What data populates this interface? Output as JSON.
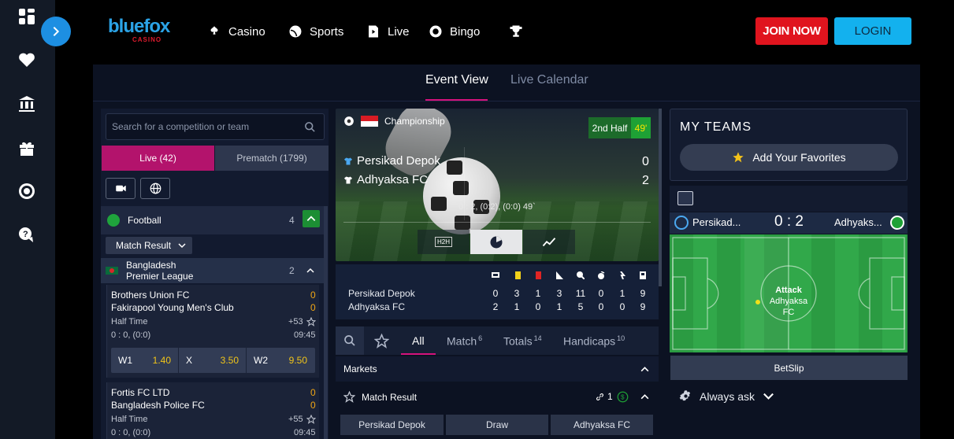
{
  "brand": {
    "name": "bluefox",
    "sub": "CASINO"
  },
  "nav": [
    "Casino",
    "Sports",
    "Live",
    "Bingo"
  ],
  "auth": {
    "join": "JOIN NOW",
    "login": "LOGIN"
  },
  "view_tabs": {
    "event_view": "Event View",
    "live_calendar": "Live Calendar"
  },
  "left": {
    "search_placeholder": "Search for a competition or team",
    "live_tab": "Live (42)",
    "prematch_tab": "Prematch (1799)",
    "sport": {
      "name": "Football",
      "count": "4"
    },
    "market_select": "Match Result",
    "league": {
      "name_line1": "Bangladesh",
      "name_line2": "Premier League",
      "count": "2"
    },
    "matches": [
      {
        "home": "Brothers Union FC",
        "away": "Fakirapool Young Men's Club",
        "home_score": "0",
        "away_score": "0",
        "period": "Half Time",
        "more": "+53",
        "detail": "0 : 0, (0:0)",
        "time": "09:45",
        "odds": [
          {
            "k": "W1",
            "v": "1.40"
          },
          {
            "k": "X",
            "v": "3.50"
          },
          {
            "k": "W2",
            "v": "9.50"
          }
        ]
      },
      {
        "home": "Fortis FC LTD",
        "away": "Bangladesh Police FC",
        "home_score": "0",
        "away_score": "0",
        "period": "Half Time",
        "more": "+55",
        "detail": "0 : 0, (0:0)",
        "time": "09:45"
      }
    ]
  },
  "event": {
    "competition": "Championship",
    "period": "2nd Half",
    "minute": "49'",
    "home": "Persikad Depok",
    "away": "Adhyaksa FC",
    "home_score": "0",
    "away_score": "2",
    "detail": "0 : 2, (0:2), (0:0) 49`",
    "h2h": "H2H",
    "stats": {
      "home_name": "Persikad Depok",
      "away_name": "Adhyaksa FC",
      "home": [
        "0",
        "3",
        "1",
        "3",
        "11",
        "0",
        "1",
        "9"
      ],
      "away": [
        "2",
        "1",
        "0",
        "1",
        "5",
        "0",
        "0",
        "9"
      ]
    }
  },
  "market_tabs": [
    {
      "label": "All",
      "count": ""
    },
    {
      "label": "Match",
      "count": "6"
    },
    {
      "label": "Totals",
      "count": "14"
    },
    {
      "label": "Handicaps",
      "count": "10"
    }
  ],
  "markets_label": "Markets",
  "match_result": {
    "name": "Match Result",
    "links": "1",
    "selections": [
      "Persikad Depok",
      "Draw",
      "Adhyaksa FC"
    ]
  },
  "right": {
    "my_teams": "MY TEAMS",
    "add_fav": "Add Your Favorites",
    "home_short": "Persikad...",
    "away_short": "Adhyaks...",
    "score": "0 : 2",
    "attack": "Attack",
    "attack_team": "Adhyaksa FC",
    "betslip": "BetSlip",
    "always_ask": "Always ask"
  },
  "colors": {
    "accent_pink": "#d4127d",
    "join_red": "#e0141e",
    "login_blue": "#13b1ee",
    "odds_yellow": "#f0c419",
    "live_green": "#1ea135"
  }
}
